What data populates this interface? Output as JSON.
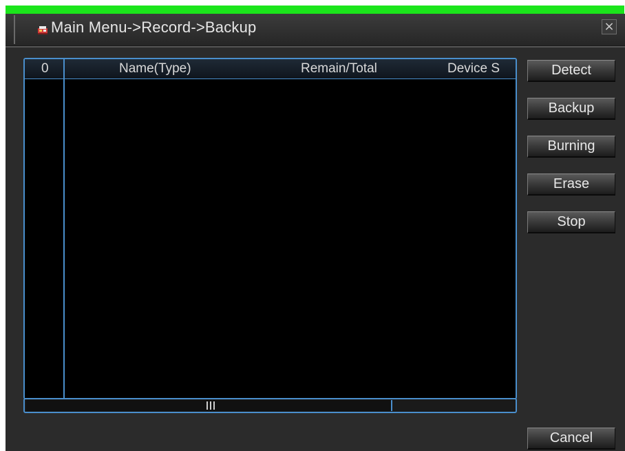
{
  "window": {
    "title": "Main Menu->Record->Backup",
    "close_glyph": "×",
    "icon": "record-menu-icon",
    "accent_color": "#4a8fcd",
    "top_bar_color": "#1be51b"
  },
  "device_list": {
    "columns": [
      "0",
      "Name(Type)",
      "Remain/Total",
      "Device S"
    ],
    "rows": []
  },
  "buttons": {
    "detect": "Detect",
    "backup": "Backup",
    "burning": "Burning",
    "erase": "Erase",
    "stop": "Stop",
    "cancel": "Cancel"
  }
}
